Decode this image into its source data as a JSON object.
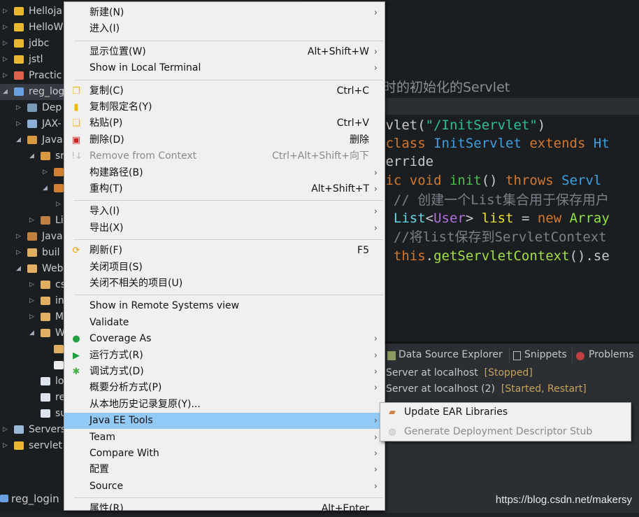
{
  "tree": {
    "items": [
      {
        "label": "Helloja",
        "level": 0,
        "twisty": "closed",
        "icon": "project-warning-icon",
        "color": "#e8b830"
      },
      {
        "label": "HelloW",
        "level": 0,
        "twisty": "closed",
        "icon": "project-warning-icon",
        "color": "#e8b830"
      },
      {
        "label": "jdbc",
        "level": 0,
        "twisty": "closed",
        "icon": "project-warning-icon",
        "color": "#e8b830"
      },
      {
        "label": "jstl",
        "level": 0,
        "twisty": "closed",
        "icon": "project-warning-icon",
        "color": "#e8b830"
      },
      {
        "label": "Practic",
        "level": 0,
        "twisty": "closed",
        "icon": "project-error-icon",
        "color": "#e06050"
      },
      {
        "label": "reg_logi",
        "level": 0,
        "twisty": "open",
        "icon": "project-icon",
        "color": "#6aa0e0",
        "selected": true
      },
      {
        "label": "Dep",
        "level": 1,
        "twisty": "closed",
        "icon": "deployment-icon",
        "color": "#7a9ab8"
      },
      {
        "label": "JAX-",
        "level": 1,
        "twisty": "closed",
        "icon": "web-service-icon",
        "color": "#8ab0d8"
      },
      {
        "label": "Java",
        "level": 1,
        "twisty": "open",
        "icon": "source-folder-icon",
        "color": "#d89a40"
      },
      {
        "label": "sr",
        "level": 2,
        "twisty": "open",
        "icon": "package-folder-icon",
        "color": "#d89a40"
      },
      {
        "label": "",
        "level": 3,
        "twisty": "closed",
        "icon": "package-icon",
        "color": "#d08030"
      },
      {
        "label": "",
        "level": 3,
        "twisty": "open",
        "icon": "package-icon",
        "color": "#d08030"
      },
      {
        "label": "",
        "level": 4,
        "twisty": "closed",
        "icon": "",
        "color": ""
      },
      {
        "label": "Li",
        "level": 2,
        "twisty": "closed",
        "icon": "library-icon",
        "color": "#c08040"
      },
      {
        "label": "Java",
        "level": 1,
        "twisty": "closed",
        "icon": "library-icon",
        "color": "#c08040"
      },
      {
        "label": "buil",
        "level": 1,
        "twisty": "closed",
        "icon": "folder-icon",
        "color": "#e0b060"
      },
      {
        "label": "Web",
        "level": 1,
        "twisty": "open",
        "icon": "folder-icon",
        "color": "#e0b060"
      },
      {
        "label": "cs",
        "level": 2,
        "twisty": "closed",
        "icon": "folder-icon",
        "color": "#e0b060"
      },
      {
        "label": "in",
        "level": 2,
        "twisty": "closed",
        "icon": "folder-icon",
        "color": "#e0b060"
      },
      {
        "label": "M",
        "level": 2,
        "twisty": "closed",
        "icon": "folder-icon",
        "color": "#e0b060"
      },
      {
        "label": "W",
        "level": 2,
        "twisty": "open",
        "icon": "folder-icon",
        "color": "#e0b060"
      },
      {
        "label": "",
        "level": 3,
        "twisty": "none",
        "icon": "folder-icon",
        "color": "#e0b060"
      },
      {
        "label": "",
        "level": 3,
        "twisty": "none",
        "icon": "xml-file-icon",
        "color": "#eeeeee"
      },
      {
        "label": "lo",
        "level": 2,
        "twisty": "none",
        "icon": "jsp-file-icon",
        "color": "#dde4ee"
      },
      {
        "label": "re",
        "level": 2,
        "twisty": "none",
        "icon": "jsp-file-icon",
        "color": "#dde4ee"
      },
      {
        "label": "su",
        "level": 2,
        "twisty": "none",
        "icon": "jsp-file-icon",
        "color": "#dde4ee"
      },
      {
        "label": "Servers",
        "level": 0,
        "twisty": "closed",
        "icon": "folder-icon",
        "color": "#9ab8d8"
      },
      {
        "label": "servlet",
        "level": 0,
        "twisty": "closed",
        "icon": "project-warning-icon",
        "color": "#e8b830"
      }
    ],
    "status_project": "reg_login"
  },
  "editor": {
    "lines": [
      {
        "y": "comment",
        "parts": [
          [
            "时的初始化的Servlet",
            "#8a8f95"
          ]
        ]
      },
      {
        "parts": [
          [
            "rvlet(",
            "#c8c8c8"
          ],
          [
            "\"/InitServlet\"",
            "#2bbf9a"
          ],
          [
            ")",
            "#c8c8c8"
          ]
        ]
      },
      {
        "parts": [
          [
            " class ",
            "#d4782c"
          ],
          [
            "InitServlet",
            "#3ca0e0"
          ],
          [
            " extends ",
            "#d4782c"
          ],
          [
            "Ht",
            "#3ca0e0"
          ]
        ]
      },
      {
        "parts": [
          [
            "verride",
            "#c8c8c8"
          ]
        ]
      },
      {
        "parts": [
          [
            "lic ",
            "#d4782c"
          ],
          [
            "void ",
            "#d4782c"
          ],
          [
            "init",
            "#4cc04c"
          ],
          [
            "() ",
            "#c8c8c8"
          ],
          [
            "throws ",
            "#d4782c"
          ],
          [
            "Servl",
            "#3ca0e0"
          ]
        ]
      },
      {
        "parts": [
          [
            "  // 创建一个List集合用于保存用户",
            "#7a8088"
          ]
        ]
      },
      {
        "parts": [
          [
            "  List",
            "#60d8e8"
          ],
          [
            "<",
            "#c8c8c8"
          ],
          [
            "User",
            "#b070e0"
          ],
          [
            "> ",
            "#c8c8c8"
          ],
          [
            "list",
            "#e8e020"
          ],
          [
            " = ",
            "#c8c8c8"
          ],
          [
            "new ",
            "#d4782c"
          ],
          [
            "Array",
            "#90e040"
          ]
        ]
      },
      {
        "parts": [
          [
            "  //将list保存到ServletContext",
            "#7a8088"
          ]
        ]
      },
      {
        "parts": [
          [
            "  this",
            "#d4782c"
          ],
          [
            ".",
            "#c8c8c8"
          ],
          [
            "getServletContext",
            "#a0e040"
          ],
          [
            "().se",
            "#c8c8c8"
          ]
        ]
      }
    ]
  },
  "panel": {
    "tabs": [
      "Data Source Explorer",
      "Snippets",
      "Problems"
    ],
    "servers": [
      {
        "name": "Server at localhost",
        "status": "[Stopped]"
      },
      {
        "name": "Server at localhost (2)",
        "status": "[Started, Restart]"
      }
    ]
  },
  "menu": {
    "items": [
      {
        "label": "新建(N)",
        "arrow": true
      },
      {
        "label": "进入(I)"
      },
      {
        "sep": true
      },
      {
        "label": "显示位置(W)",
        "shortcut": "Alt+Shift+W",
        "arrow": true
      },
      {
        "label": "Show in Local Terminal",
        "arrow": true
      },
      {
        "sep": true
      },
      {
        "label": "复制(C)",
        "shortcut": "Ctrl+C",
        "icon": "copy-icon"
      },
      {
        "label": "复制限定名(Y)",
        "icon": "copy-qualified-name-icon"
      },
      {
        "label": "粘贴(P)",
        "shortcut": "Ctrl+V",
        "icon": "paste-icon"
      },
      {
        "label": "删除(D)",
        "shortcut": "删除",
        "icon": "delete-icon"
      },
      {
        "label": "Remove from Context",
        "shortcut": "Ctrl+Alt+Shift+向下",
        "icon": "remove-context-icon",
        "disabled": true
      },
      {
        "label": "构建路径(B)",
        "arrow": true
      },
      {
        "label": "重构(T)",
        "shortcut": "Alt+Shift+T",
        "arrow": true
      },
      {
        "sep": true
      },
      {
        "label": "导入(I)",
        "arrow": true
      },
      {
        "label": "导出(X)",
        "arrow": true
      },
      {
        "sep": true
      },
      {
        "label": "刷新(F)",
        "shortcut": "F5",
        "icon": "refresh-icon"
      },
      {
        "label": "关闭项目(S)"
      },
      {
        "label": "关闭不相关的项目(U)"
      },
      {
        "sep": true
      },
      {
        "label": "Show in Remote Systems view"
      },
      {
        "label": "Validate"
      },
      {
        "label": "Coverage As",
        "arrow": true,
        "icon": "coverage-icon"
      },
      {
        "label": "运行方式(R)",
        "arrow": true,
        "icon": "run-icon"
      },
      {
        "label": "调试方式(D)",
        "arrow": true,
        "icon": "debug-icon"
      },
      {
        "label": "概要分析方式(P)",
        "arrow": true
      },
      {
        "label": "从本地历史记录复原(Y)..."
      },
      {
        "label": "Java EE Tools",
        "arrow": true,
        "highlighted": true
      },
      {
        "label": "Team",
        "arrow": true
      },
      {
        "label": "Compare With",
        "arrow": true
      },
      {
        "label": "配置",
        "arrow": true
      },
      {
        "label": "Source",
        "arrow": true
      },
      {
        "sep": true
      },
      {
        "label": "属性(R)",
        "shortcut": "Alt+Enter"
      }
    ],
    "arrow_glyph": "›"
  },
  "submenu": {
    "items": [
      {
        "label": "Update EAR Libraries",
        "icon": "library-icon"
      },
      {
        "label": "Generate Deployment Descriptor Stub",
        "icon": "descriptor-icon",
        "disabled": true
      }
    ]
  },
  "watermark": "https://blog.csdn.net/makersy",
  "colors": {
    "menu_bg": "#f0f0f0",
    "highlight": "#91c9f7",
    "editor_bg": "#1b1e21",
    "status_text": "#c8a35a"
  }
}
